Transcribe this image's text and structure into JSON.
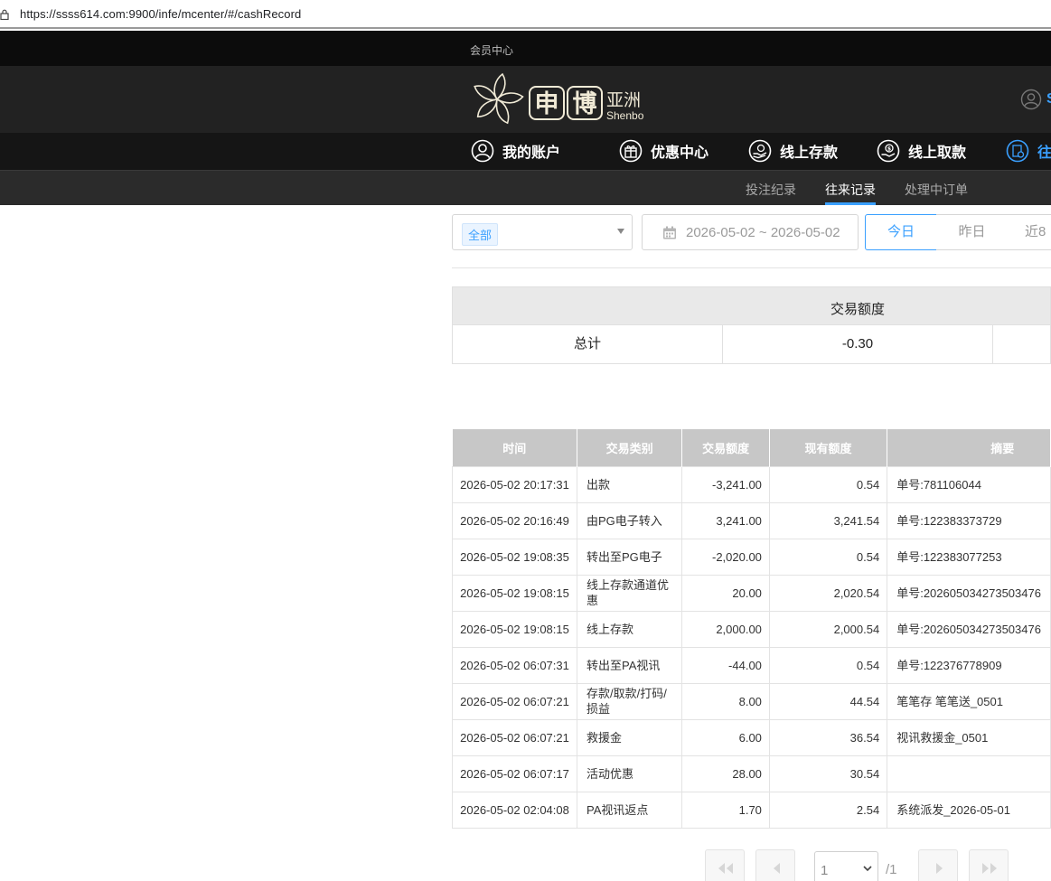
{
  "browser": {
    "url": "https://ssss614.com:9900/infe/mcenter/#/cashRecord"
  },
  "header": {
    "member_center_label": "会员中心",
    "brand": {
      "char1": "申",
      "char2": "博",
      "cn_suffix": "亚洲",
      "en_name": "Shenbo"
    },
    "user_initial": "S"
  },
  "nav": {
    "items": [
      {
        "label": "我的账户",
        "icon": "user-circle-icon"
      },
      {
        "label": "优惠中心",
        "icon": "gift-icon"
      },
      {
        "label": "线上存款",
        "icon": "deposit-hand-icon"
      },
      {
        "label": "线上取款",
        "icon": "withdraw-coin-icon"
      },
      {
        "label": "往",
        "icon": "record-icon",
        "active": true
      }
    ],
    "subtabs": [
      "投注纪录",
      "往来记录",
      "处理中订单"
    ],
    "active_subtab": "往来记录"
  },
  "filters": {
    "type_tag": "全部",
    "date_range": "2026-05-02 ~ 2026-05-02",
    "quick_ranges": [
      "今日",
      "昨日",
      "近8"
    ],
    "active_quick": "今日"
  },
  "summary": {
    "header": "交易额度",
    "row_label": "总计",
    "total": "-0.30"
  },
  "table": {
    "headers": [
      "时间",
      "交易类别",
      "交易额度",
      "现有额度",
      "摘要"
    ],
    "rows": [
      [
        "2026-05-02 20:17:31",
        "出款",
        "-3,241.00",
        "0.54",
        "单号:781106044"
      ],
      [
        "2026-05-02 20:16:49",
        "由PG电子转入",
        "3,241.00",
        "3,241.54",
        "单号:122383373729"
      ],
      [
        "2026-05-02 19:08:35",
        "转出至PG电子",
        "-2,020.00",
        "0.54",
        "单号:122383077253"
      ],
      [
        "2026-05-02 19:08:15",
        "线上存款通道优惠",
        "20.00",
        "2,020.54",
        "单号:202605034273503476"
      ],
      [
        "2026-05-02 19:08:15",
        "线上存款",
        "2,000.00",
        "2,000.54",
        "单号:202605034273503476"
      ],
      [
        "2026-05-02 06:07:31",
        "转出至PA视讯",
        "-44.00",
        "0.54",
        "单号:122376778909"
      ],
      [
        "2026-05-02 06:07:21",
        "存款/取款/打码/损益",
        "8.00",
        "44.54",
        "笔笔存 笔笔送_0501"
      ],
      [
        "2026-05-02 06:07:21",
        "救援金",
        "6.00",
        "36.54",
        "视讯救援金_0501"
      ],
      [
        "2026-05-02 06:07:17",
        "活动优惠",
        "28.00",
        "30.54",
        ""
      ],
      [
        "2026-05-02 02:04:08",
        "PA视讯返点",
        "1.70",
        "2.54",
        "系统派发_2026-05-01"
      ]
    ]
  },
  "pagination": {
    "current": "1",
    "total_label": "/1"
  }
}
